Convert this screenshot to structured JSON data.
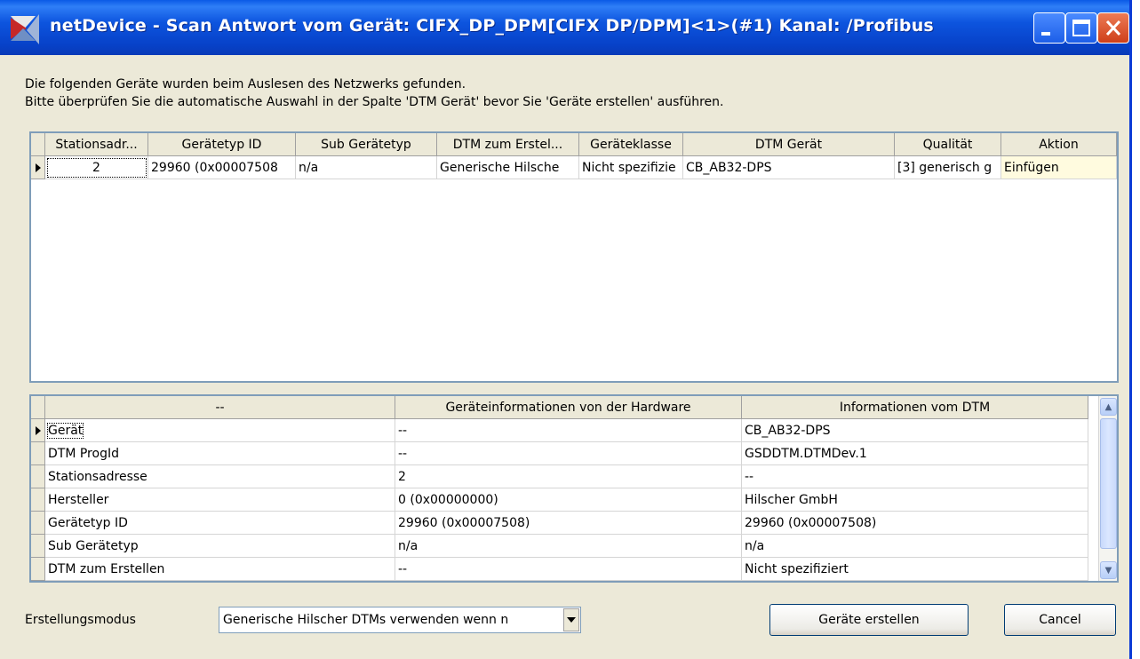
{
  "window": {
    "title": "netDevice - Scan Antwort vom Gerät: CIFX_DP_DPM[CIFX DP/DPM]<1>(#1) Kanal: /Profibus"
  },
  "instructions": {
    "line1": "Die folgenden Geräte wurden beim Auslesen des Netzwerks gefunden.",
    "line2": "Bitte überprüfen Sie die automatische Auswahl in der Spalte 'DTM Gerät' bevor Sie 'Geräte erstellen' ausführen."
  },
  "device_grid": {
    "columns": [
      "Stationsadr...",
      "Gerätetyp ID",
      "Sub Gerätetyp",
      "DTM zum Erstel...",
      "Geräteklasse",
      "DTM Gerät",
      "Qualität",
      "Aktion"
    ],
    "rows": [
      [
        "2",
        "29960 (0x00007508",
        "n/a",
        "Generische Hilsche",
        "Nicht spezifizie",
        "CB_AB32-DPS",
        "[3] generisch g",
        "Einfügen"
      ]
    ]
  },
  "info_grid": {
    "columns": [
      "--",
      "Geräteinformationen von der Hardware",
      "Informationen vom DTM"
    ],
    "rows": [
      [
        "Gerät",
        "--",
        "CB_AB32-DPS"
      ],
      [
        "DTM ProgId",
        "--",
        "GSDDTM.DTMDev.1"
      ],
      [
        "Stationsadresse",
        "2",
        "--"
      ],
      [
        "Hersteller",
        "0 (0x00000000)",
        "Hilscher GmbH"
      ],
      [
        "Gerätetyp ID",
        "29960 (0x00007508)",
        "29960 (0x00007508)"
      ],
      [
        "Sub Gerätetyp",
        "n/a",
        "n/a"
      ],
      [
        "DTM zum Erstellen",
        "--",
        "Nicht spezifiziert"
      ]
    ]
  },
  "footer": {
    "mode_label": "Erstellungsmodus",
    "mode_value": "Generische Hilscher DTMs verwenden wenn n",
    "create_button": "Geräte erstellen",
    "cancel_button": "Cancel"
  },
  "icons": {
    "app": "netdevice-app-icon",
    "minimize": "minimize-icon",
    "maximize": "maximize-icon",
    "close": "close-icon",
    "row_pointer": "row-pointer-icon",
    "scroll_up": "scroll-up-icon",
    "scroll_down": "scroll-down-icon",
    "dropdown": "chevron-down-icon"
  },
  "colors": {
    "titlebar": "#0a4fd8",
    "close_button": "#d9481f",
    "editable_cell": "#fffbdf"
  }
}
